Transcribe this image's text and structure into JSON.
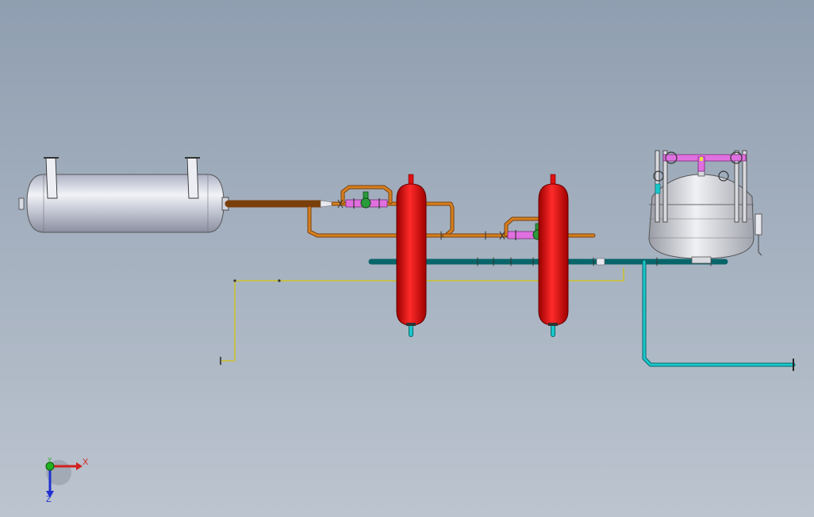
{
  "viewport": {
    "background_top": "#8f9eb0",
    "background_bottom": "#bcc4cf"
  },
  "colors": {
    "orange_pipe": "#c8721e",
    "cyan_pipe": "#19c8cc",
    "yellow_line": "#c8c040",
    "red_vessel": "#e01010",
    "pink_fitting": "#e070e0",
    "green_valve": "#2a9a3a",
    "grey_vessel": "#c9ccd6"
  },
  "components": [
    {
      "name": "horizontal-tank",
      "icon": "horizontal-pressure-vessel"
    },
    {
      "name": "red-vessel-1",
      "icon": "vertical-pressure-vessel"
    },
    {
      "name": "red-vessel-2",
      "icon": "vertical-pressure-vessel"
    },
    {
      "name": "filter-tank",
      "icon": "dished-vessel"
    },
    {
      "name": "valve-1",
      "icon": "ball-valve"
    },
    {
      "name": "valve-2",
      "icon": "ball-valve"
    }
  ],
  "triad": {
    "x_label": "X",
    "y_label": "Y",
    "z_label": "Z",
    "x_color": "#d22020",
    "y_color": "#20b020",
    "z_color": "#2030d0"
  }
}
